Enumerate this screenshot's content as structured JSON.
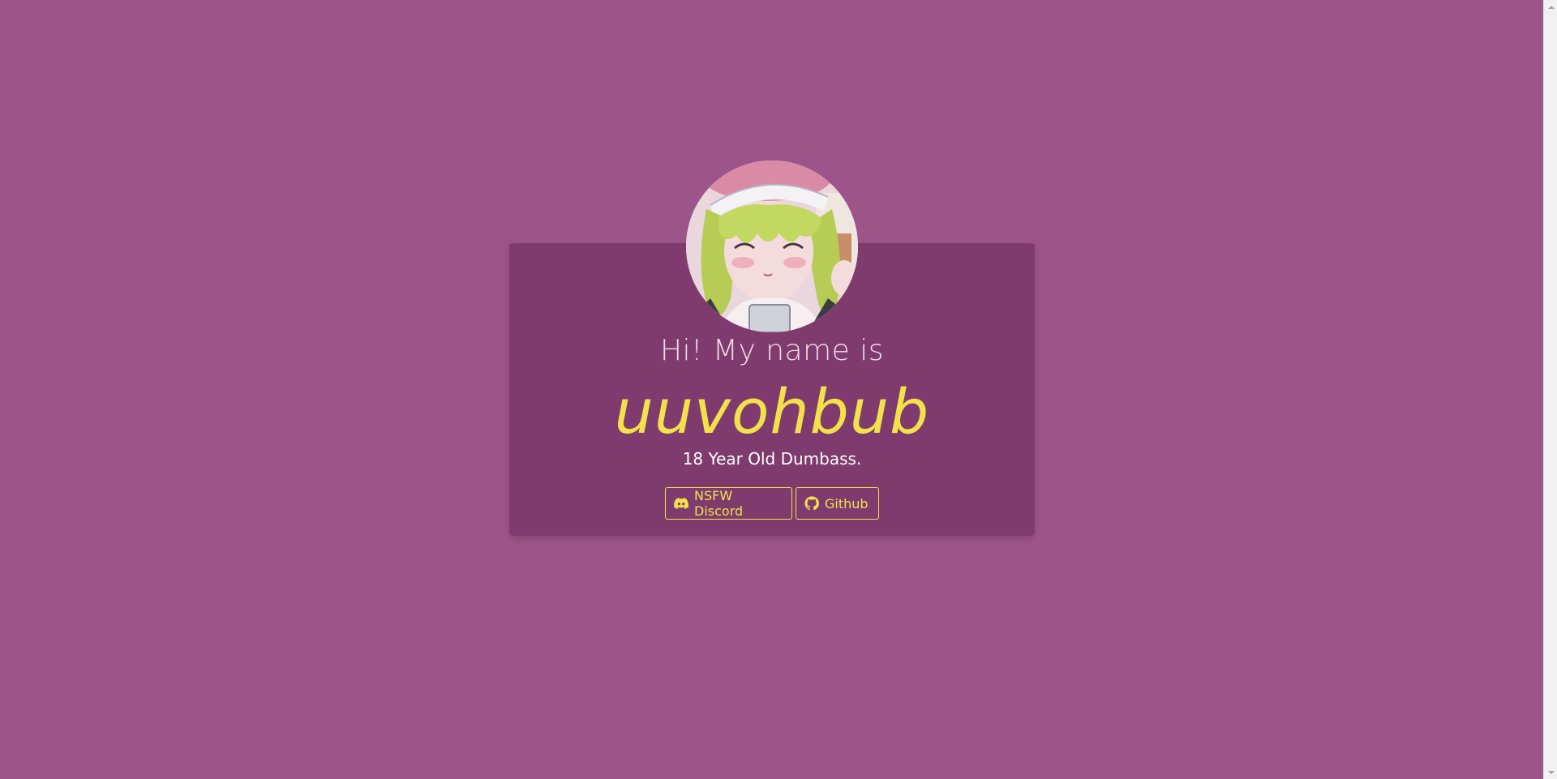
{
  "profile": {
    "greeting": "Hi! My name is",
    "name": "uuvohbub",
    "tagline": "18 Year Old Dumbass.",
    "avatar_alt": "avatar"
  },
  "links": [
    {
      "label": "NSFW Discord",
      "icon": "discord-icon"
    },
    {
      "label": "Github",
      "icon": "github-icon"
    }
  ],
  "colors": {
    "background": "#9d5589",
    "card": "#7f3b6e",
    "accent": "#f2e14a",
    "greeting_text": "#f3dbe9",
    "tagline_text": "#ffffff"
  }
}
